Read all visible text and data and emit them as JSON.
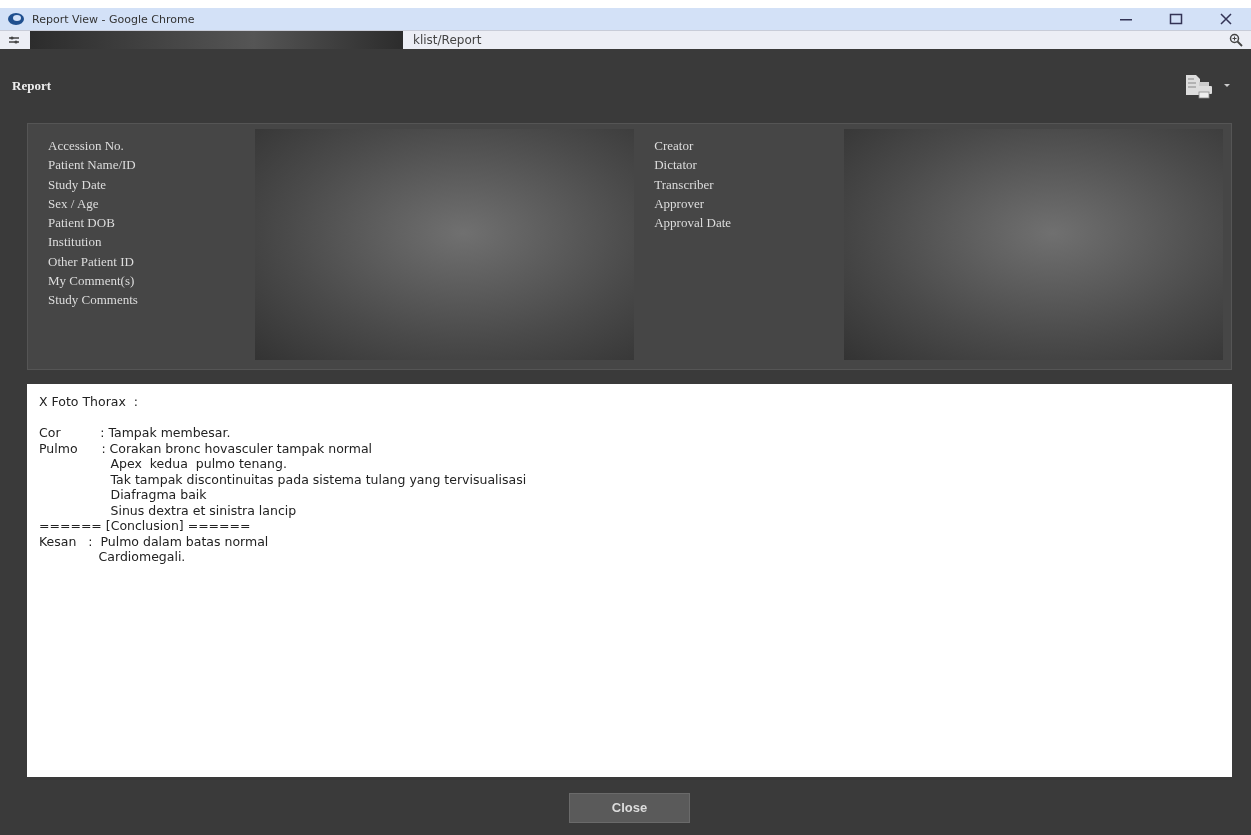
{
  "window": {
    "title": "Report View - Google Chrome"
  },
  "address_bar": {
    "url": "klist/Report"
  },
  "report": {
    "title": "Report",
    "info_left": [
      "Accession No.",
      "Patient Name/ID",
      "Study Date",
      "Sex / Age",
      "Patient DOB",
      "Institution",
      "Other Patient ID",
      "My Comment(s)",
      "Study Comments"
    ],
    "info_right": [
      "Creator",
      "Dictator",
      "Transcriber",
      "Approver",
      "Approval Date"
    ],
    "text_lines": [
      "X Foto Thorax  :",
      "Cor          : Tampak membesar.",
      "Pulmo      : Corakan bronc hovasculer tampak normal",
      "                  Apex  kedua  pulmo tenang.",
      "                  Tak tampak discontinuitas pada sistema tulang yang tervisualisasi",
      "                  Diafragma baik",
      "                  Sinus dextra et sinistra lancip",
      "====== [Conclusion] ======",
      "Kesan   :  Pulmo dalam batas normal",
      "               Cardiomegali."
    ]
  },
  "buttons": [
    "Close"
  ]
}
